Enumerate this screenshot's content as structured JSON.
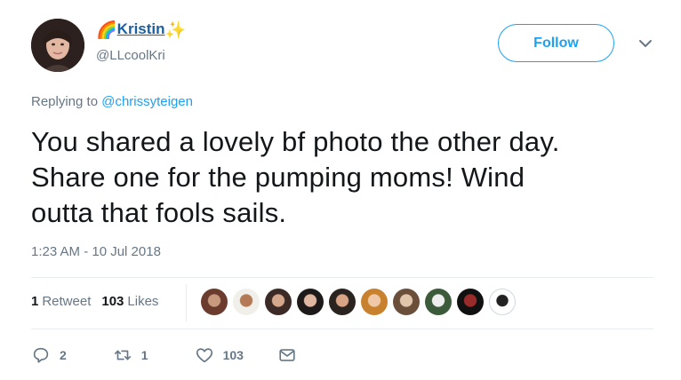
{
  "user": {
    "name_prefix_emoji": "🌈",
    "name": "Kristin",
    "name_suffix_emoji": "✨",
    "handle": "@LLcoolKri"
  },
  "header": {
    "follow_label": "Follow"
  },
  "tweet": {
    "replying_prefix": "Replying to",
    "replying_to": "@chrissyteigen",
    "text_lines": [
      "You shared a lovely bf photo the other day.",
      "Share one for the pumping moms! Wind",
      "outta that fools sails."
    ],
    "timestamp": "1:23 AM - 10 Jul 2018"
  },
  "stats": {
    "retweet_count": "1",
    "retweet_label": "Retweet",
    "like_count": "103",
    "like_label": "Likes"
  },
  "likers": [
    {
      "colors": [
        "#6b3b2e",
        "#c79a7e"
      ]
    },
    {
      "colors": [
        "#f1efe9",
        "#b37a55"
      ]
    },
    {
      "colors": [
        "#3b2a26",
        "#d4a88c"
      ]
    },
    {
      "colors": [
        "#1e1a1a",
        "#e0b7a1"
      ]
    },
    {
      "colors": [
        "#2a2320",
        "#d9a486"
      ]
    },
    {
      "colors": [
        "#c8822d",
        "#f0c9a9"
      ]
    },
    {
      "colors": [
        "#6b4f3b",
        "#e2c6ac"
      ]
    },
    {
      "colors": [
        "#3c5b3a",
        "#eeeeee"
      ]
    },
    {
      "colors": [
        "#111111",
        "#9a2b2b"
      ]
    },
    {
      "colors": [
        "#ffffff",
        "#222222"
      ]
    }
  ],
  "actions": {
    "reply_count": "2",
    "retweet_count": "1",
    "like_count": "103"
  },
  "colors": {
    "accent": "#1da1f2",
    "muted": "#657786",
    "text": "#14171a",
    "divider": "#e6ecf0"
  },
  "icons": {
    "caret": "chevron-down-icon",
    "reply": "reply-icon",
    "retweet": "retweet-icon",
    "like": "heart-icon",
    "dm": "envelope-icon"
  }
}
